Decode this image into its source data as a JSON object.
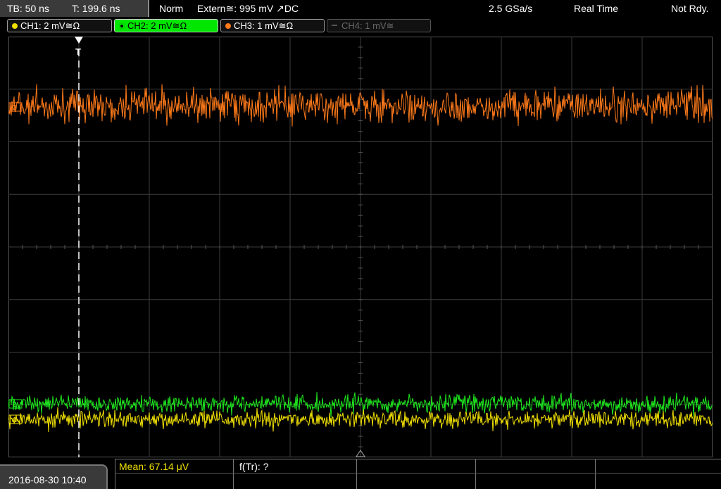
{
  "header": {
    "tb": "TB: 50 ns",
    "t": "T: 199.6 ns",
    "mode": "Norm",
    "trigger": "Extern≅: 995 mV ↗DC",
    "rate": "2.5 GSa/s",
    "acq": "Real Time",
    "status": "Not Rdy."
  },
  "channels": [
    {
      "label": "CH1: 2 mV≅Ω",
      "color": "#f0e000",
      "active": false
    },
    {
      "label": "CH2: 2 mV≅Ω",
      "color": "#00dd00",
      "active": true
    },
    {
      "label": "CH3: 1 mV≅Ω",
      "color": "#ff7a1a",
      "active": false
    },
    {
      "label": "CH4: 1 mV≅",
      "color": "#666666",
      "active": false
    }
  ],
  "markers": {
    "trigger": "T",
    "ch3": "3",
    "ch2": "2",
    "ch1": "1"
  },
  "footer": {
    "datetime": "2016-08-30 10:40",
    "mean": "Mean: 67.14 μV",
    "freq": "f(Tr): ?"
  },
  "colors": {
    "ch1": "#f0e000",
    "ch2": "#1ee81e",
    "ch3": "#ff7a1a",
    "grid": "#3c3c3c"
  }
}
